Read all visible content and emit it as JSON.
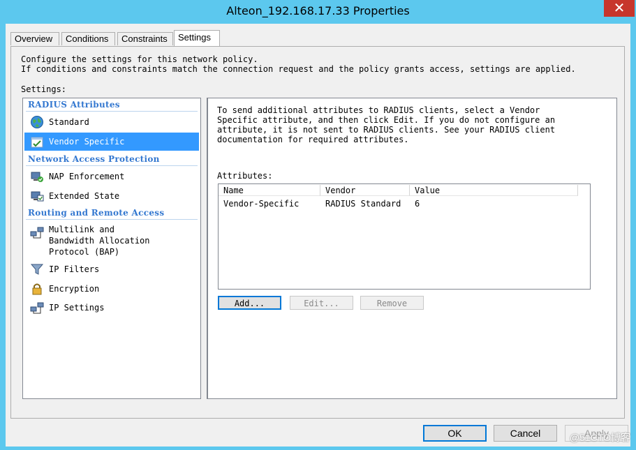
{
  "window": {
    "title": "Alteon_192.168.17.33 Properties",
    "close_symbol": "✕"
  },
  "tabs": [
    {
      "label": "Overview"
    },
    {
      "label": "Conditions"
    },
    {
      "label": "Constraints"
    },
    {
      "label": "Settings"
    }
  ],
  "settings_tab": {
    "description": "Configure the settings for this network policy.\nIf conditions and constraints match the connection request and the policy grants access, settings are applied.",
    "settings_label": "Settings:",
    "groups": [
      {
        "heading": "RADIUS Attributes",
        "items": [
          {
            "label": "Standard",
            "icon": "globe-icon"
          },
          {
            "label": "Vendor Specific",
            "icon": "checkbox-window-icon",
            "selected": true
          }
        ]
      },
      {
        "heading": "Network Access Protection",
        "items": [
          {
            "label": "NAP Enforcement",
            "icon": "nap-enforcement-icon"
          },
          {
            "label": "Extended State",
            "icon": "extended-state-icon"
          }
        ]
      },
      {
        "heading": "Routing and Remote Access",
        "items": [
          {
            "label": "Multilink and\nBandwidth Allocation\nProtocol (BAP)",
            "icon": "network-computers-icon"
          },
          {
            "label": "IP Filters",
            "icon": "filter-icon"
          },
          {
            "label": "Encryption",
            "icon": "lock-icon"
          },
          {
            "label": "IP Settings",
            "icon": "network-computers-icon"
          }
        ]
      }
    ],
    "right_text": "To send additional attributes to RADIUS clients, select a Vendor\nSpecific attribute, and then click Edit. If you do not configure an\nattribute, it is not sent to RADIUS clients. See your RADIUS client\ndocumentation for required attributes.",
    "attributes_label": "Attributes:",
    "table": {
      "columns": [
        "Name",
        "Vendor",
        "Value"
      ],
      "rows": [
        [
          "Vendor-Specific",
          "RADIUS Standard",
          "6"
        ]
      ]
    },
    "buttons": {
      "add": "Add...",
      "edit": "Edit...",
      "remove": "Remove"
    }
  },
  "footer": {
    "ok": "OK",
    "cancel": "Cancel",
    "apply": "Apply"
  },
  "watermark": "@51CTO博客"
}
